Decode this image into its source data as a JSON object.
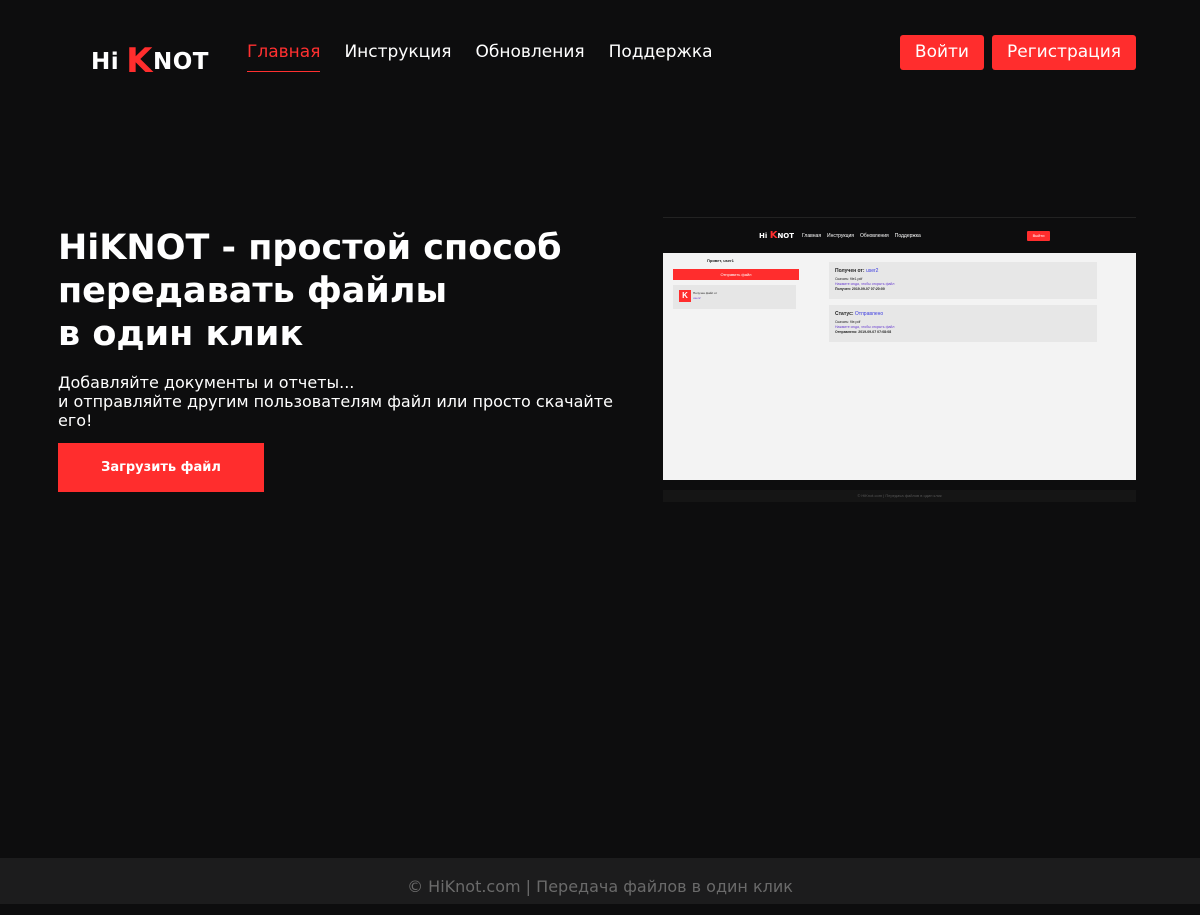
{
  "header": {
    "logo": {
      "hi": "Hi",
      "k": "K",
      "not": "NOT"
    },
    "nav": [
      "Главная",
      "Инструкция",
      "Обновления",
      "Поддержка"
    ],
    "login_label": "Войти",
    "register_label": "Регистрация"
  },
  "hero": {
    "title": "HiKNOT - простой способ\nпередавать файлы\nв один клик",
    "subtitle": "Добавляйте документы и отчеты...\nи отправляйте другим пользователям файл или просто скачайте его!",
    "cta_label": "Загрузить файл"
  },
  "preview": {
    "logo": {
      "hi": "Hi ",
      "k": "K",
      "not": "NOT"
    },
    "nav": [
      "Главная",
      "Инструкция",
      "Обновления",
      "Поддержка"
    ],
    "login_label": "Выйти",
    "greeting": "Привет, user1",
    "send_label": "Отправить файл",
    "recv_k": "K",
    "recv_title": "Получен файл от",
    "recv_user": "user2",
    "card1": {
      "heading": "Получен от:",
      "user": "user2",
      "download": "Скачать: file1.pdf",
      "hint": "Нажмите сюда, чтобы открыть файл",
      "date": "Получен: 2019-09-07 07:20:00"
    },
    "card2": {
      "heading": "Статус:",
      "status": "Отправлено",
      "download": "Скачать: file.pdf",
      "hint": "Нажмите сюда, чтобы открыть файл",
      "date": "Отправлено: 2019-09-07 07:08:08"
    },
    "footer": "© HiKnot.com | Передача файлов в один клик"
  },
  "footer": {
    "text": "© HiKnot.com | Передача файлов в один клик"
  },
  "colors": {
    "accent": "#ff2d2d",
    "background": "#0d0d0e",
    "footer_bg": "#1c1c1d"
  }
}
